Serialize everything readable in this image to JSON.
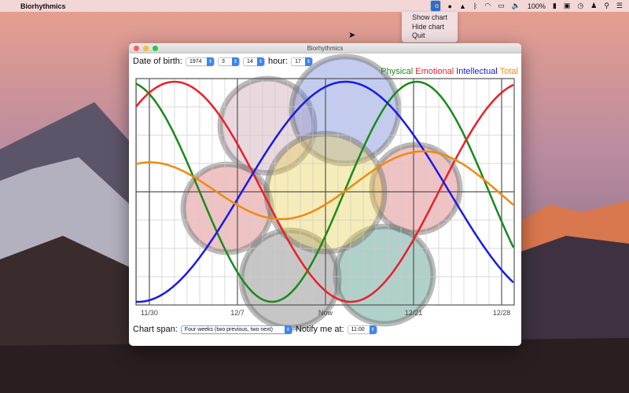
{
  "menubar": {
    "app_name": "Biorhythmics",
    "battery": "100%"
  },
  "status_menu": {
    "items": [
      "Show chart",
      "Hide chart",
      "Quit"
    ]
  },
  "window": {
    "title": "Biorhythmics"
  },
  "controls": {
    "dob_label": "Date of birth:",
    "year": "1974",
    "month": "3",
    "day": "14",
    "hour_label": "hour:",
    "hour": "17",
    "span_label": "Chart span:",
    "span_value": "Four weeks (two previous, two next)",
    "notify_label": "Notify me at:",
    "notify_value": "11:00"
  },
  "colors": {
    "physical": "#1a8a1a",
    "emotional": "#e8202a",
    "intellectual": "#1a1ae8",
    "total": "#f08a10"
  },
  "chart_data": {
    "type": "line",
    "title": "",
    "xlabel": "",
    "ylabel": "",
    "x_range_days": [
      -15.06,
      15
    ],
    "ylim": [
      -1.05,
      1.05
    ],
    "grid": true,
    "x_ticks": [
      {
        "day": -14,
        "label": "11/30"
      },
      {
        "day": -7,
        "label": "12/7"
      },
      {
        "day": 0,
        "label": "Now"
      },
      {
        "day": 7,
        "label": "12/21"
      },
      {
        "day": 14,
        "label": "12/28"
      }
    ],
    "legend": [
      "Physical",
      "Emotional",
      "Intellectual",
      "Total"
    ],
    "legend_position": "top-right",
    "series": [
      {
        "name": "Physical",
        "period_days": 23,
        "peak_day": 7.25
      },
      {
        "name": "Emotional",
        "period_days": 28,
        "peak_day": -12
      },
      {
        "name": "Intellectual",
        "period_days": 33,
        "peak_day": 1.6
      },
      {
        "name": "Total",
        "average_of": [
          "Physical",
          "Emotional",
          "Intellectual"
        ]
      }
    ]
  }
}
